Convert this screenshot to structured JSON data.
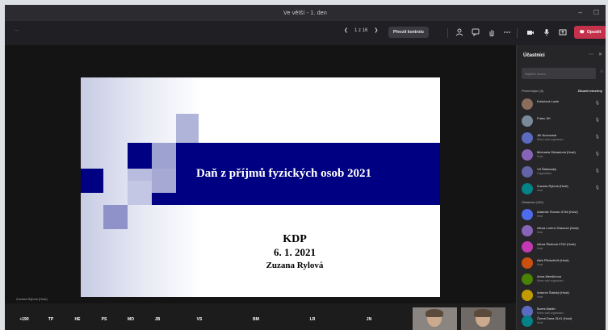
{
  "window": {
    "title": "Ve větší - 1. den",
    "controls": [
      "–",
      "☐"
    ]
  },
  "toolbar": {
    "timer": "—",
    "pager": {
      "prev": "❮",
      "label": "1 z 16",
      "next": "❯"
    },
    "control_btn": "Převzít kontrolu",
    "leave_btn": "Opustit",
    "icons": [
      "people-icon",
      "chat-icon",
      "hand-icon",
      "more-icon",
      "camera-icon",
      "mic-icon",
      "share-icon"
    ]
  },
  "slide": {
    "title": "Daň z příjmů fyzických osob 2021",
    "line1": "KDP",
    "line2": "6. 1. 2021",
    "line3": "Zuzana Rylová"
  },
  "presenter_label": "Zuzana Rylová (Host)",
  "bottom_avatars": [
    {
      "initials": "+190",
      "color": "#5b6cbe"
    },
    {
      "initials": "TP",
      "color": "#6264a7"
    },
    {
      "initials": "HE",
      "color": "#8a8a8a"
    },
    {
      "initials": "PS",
      "color": "#d13438"
    },
    {
      "initials": "MO",
      "color": "#c239b3"
    },
    {
      "initials": "JB",
      "color": "#e3008c"
    },
    {
      "initials": "VS",
      "color": "#c4314b"
    },
    {
      "initials": "BM",
      "color": "#4f6bed"
    },
    {
      "initials": "LR",
      "color": "#ca5010"
    },
    {
      "initials": "JN",
      "color": "#5c6bc0"
    }
  ],
  "panel": {
    "title": "Účastníci",
    "search_placeholder": "Najděte osobu",
    "presenters_label": "Prezentující (6)",
    "mute_all": "Ztlumit všechny",
    "presenters": [
      {
        "name": "Kalužová Lucie",
        "role": "",
        "initials": "KL",
        "color": "#8a6d5a"
      },
      {
        "name": "Franc Jiří",
        "role": "",
        "initials": "FJ",
        "color": "#7a8a9a"
      },
      {
        "name": "Jiří Novosmal",
        "role": "Mimo vaši organizaci",
        "initials": "JN",
        "color": "#5c6bc0"
      },
      {
        "name": "Michaela Slimadová (Host)",
        "role": "Host",
        "initials": "MS",
        "color": "#8764b8"
      },
      {
        "name": "Vít Šálkovský",
        "role": "Organizátor",
        "initials": "VŠ",
        "color": "#6264a7"
      },
      {
        "name": "Zuzana Rylová (Host)",
        "role": "Host",
        "initials": "ZR",
        "color": "#038387"
      }
    ],
    "attendees_label": "Účastníci (190)",
    "attendees": [
      {
        "name": "Adámek Roman 3748 (Host)",
        "role": "Host",
        "initials": "AR",
        "color": "#4f6bed"
      },
      {
        "name": "Alena Lorenc Hrazová (Host)",
        "role": "Host",
        "initials": "AL",
        "color": "#8764b8"
      },
      {
        "name": "Alena Šindová 2762 (Host)",
        "role": "Host",
        "initials": "AŠ",
        "color": "#c239b3"
      },
      {
        "name": "Aleš Pfeinchhöl (Host)",
        "role": "Host",
        "initials": "AP",
        "color": "#ca5010"
      },
      {
        "name": "Anna Menšíková",
        "role": "Mimo vaši organizaci",
        "initials": "AM",
        "color": "#498205"
      },
      {
        "name": "Antonín Šatický (Host)",
        "role": "Host",
        "initials": "AŠ",
        "color": "#c19c00"
      },
      {
        "name": "Bures Martin",
        "role": "Mimo vaši organizaci",
        "initials": "BM",
        "color": "#5c6bc0"
      },
      {
        "name": "Čemá Dana 3141 (Host)",
        "role": "Host",
        "initials": "ČD",
        "color": "#038387"
      }
    ]
  }
}
